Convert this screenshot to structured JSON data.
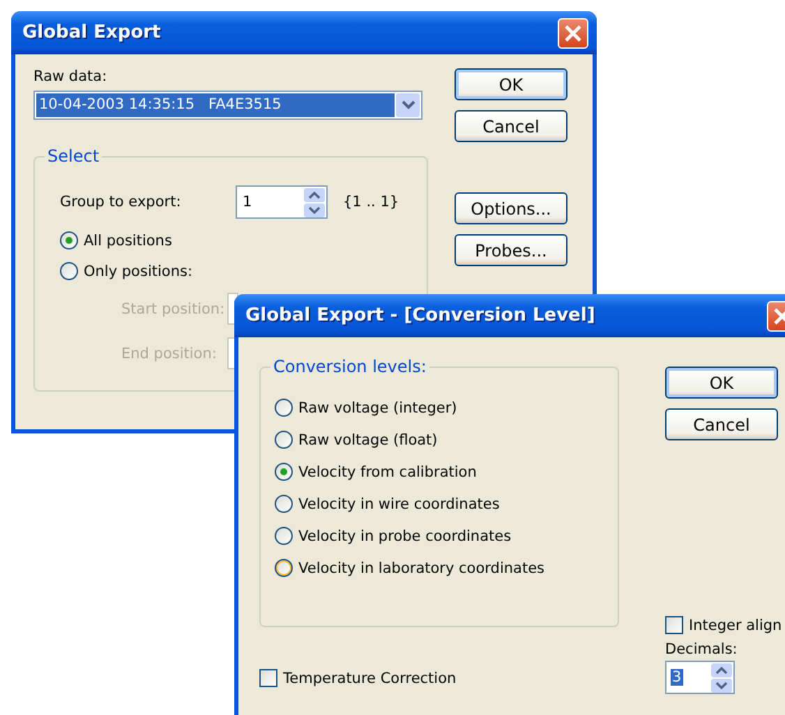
{
  "main_dialog": {
    "title": "Global Export",
    "raw_data": {
      "label": "Raw data:",
      "value": "10-04-2003 14:35:15   FA4E3515"
    },
    "select_group": {
      "title": "Select",
      "group_label": "Group to export:",
      "group_value": "1",
      "group_range": "{1 .. 1}",
      "positions": [
        {
          "label": "All positions",
          "selected": true
        },
        {
          "label": "Only positions:",
          "selected": false
        }
      ],
      "fields": [
        {
          "label": "Start position:",
          "disabled": true
        },
        {
          "label": "End position:",
          "disabled": true
        }
      ]
    },
    "buttons": [
      {
        "label": "OK",
        "default": true
      },
      {
        "label": "Cancel",
        "default": false
      },
      {
        "label": "Options...",
        "default": false
      },
      {
        "label": "Probes...",
        "default": false
      }
    ]
  },
  "conversion_dialog": {
    "title": "Global Export - [Conversion Level]",
    "group_title": "Conversion levels:",
    "levels": [
      {
        "label": "Raw voltage (integer)",
        "selected": false,
        "hovered": false
      },
      {
        "label": "Raw voltage (float)",
        "selected": false,
        "hovered": false
      },
      {
        "label": "Velocity from calibration",
        "selected": true,
        "hovered": false
      },
      {
        "label": "Velocity in wire coordinates",
        "selected": false,
        "hovered": false
      },
      {
        "label": "Velocity in probe coordinates",
        "selected": false,
        "hovered": false
      },
      {
        "label": "Velocity in laboratory coordinates",
        "selected": false,
        "hovered": true
      }
    ],
    "buttons": [
      {
        "label": "OK",
        "default": true
      },
      {
        "label": "Cancel",
        "default": false
      }
    ],
    "integer_align": {
      "label": "Integer align",
      "checked": false
    },
    "decimals": {
      "label": "Decimals:",
      "value": "3"
    },
    "temperature_correction": {
      "label": "Temperature Correction",
      "checked": false
    }
  }
}
